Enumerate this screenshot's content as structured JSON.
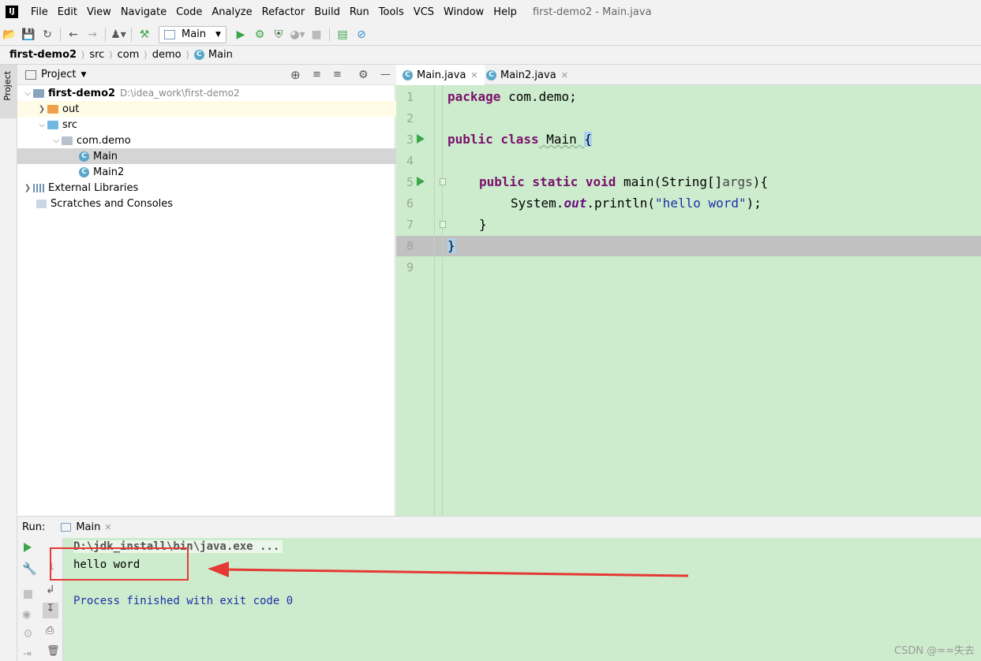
{
  "app": {
    "logo": "IJ",
    "window_title": "first-demo2 - Main.java"
  },
  "menu": [
    "File",
    "Edit",
    "View",
    "Navigate",
    "Code",
    "Analyze",
    "Refactor",
    "Build",
    "Run",
    "Tools",
    "VCS",
    "Window",
    "Help"
  ],
  "toolbar": {
    "run_config": "Main"
  },
  "breadcrumb": [
    "first-demo2",
    "src",
    "com",
    "demo",
    "Main"
  ],
  "left_stripe": {
    "project_tab": "Project"
  },
  "project": {
    "header": "Project",
    "root": {
      "name": "first-demo2",
      "path": "D:\\idea_work\\first-demo2"
    },
    "items": {
      "out": "out",
      "src": "src",
      "package": "com.demo",
      "main": "Main",
      "main2": "Main2",
      "libs": "External Libraries",
      "scratches": "Scratches and Consoles"
    }
  },
  "editor": {
    "tabs": [
      "Main.java",
      "Main2.java"
    ],
    "line_numbers": [
      "1",
      "2",
      "3",
      "4",
      "5",
      "6",
      "7",
      "8",
      "9"
    ],
    "code": {
      "l1_kw": "package",
      "l1_rest": " com.demo;",
      "l3_kw": "public class",
      "l3_name": " Main ",
      "l3_brace": "{",
      "l5_kw": "public static void",
      "l5_rest": " main(String[]",
      "l5_param": "args",
      "l5_end": "){",
      "l6_a": "System.",
      "l6_field": "out",
      "l6_b": ".println(",
      "l6_str": "\"hello word\"",
      "l6_c": ");",
      "l7": "}",
      "l8": "}"
    }
  },
  "run": {
    "label": "Run:",
    "tab": "Main",
    "console": [
      "D:\\jdk_install\\bin\\java.exe ...",
      "hello word",
      "Process finished with exit code 0"
    ]
  },
  "watermark": "CSDN @==失去",
  "colors": {
    "editor_bg": "#cdeccd",
    "annotation": "#e53935",
    "run_green": "#3aa64a",
    "keyword": "#7a0f6b",
    "string": "#1c2fa8"
  }
}
